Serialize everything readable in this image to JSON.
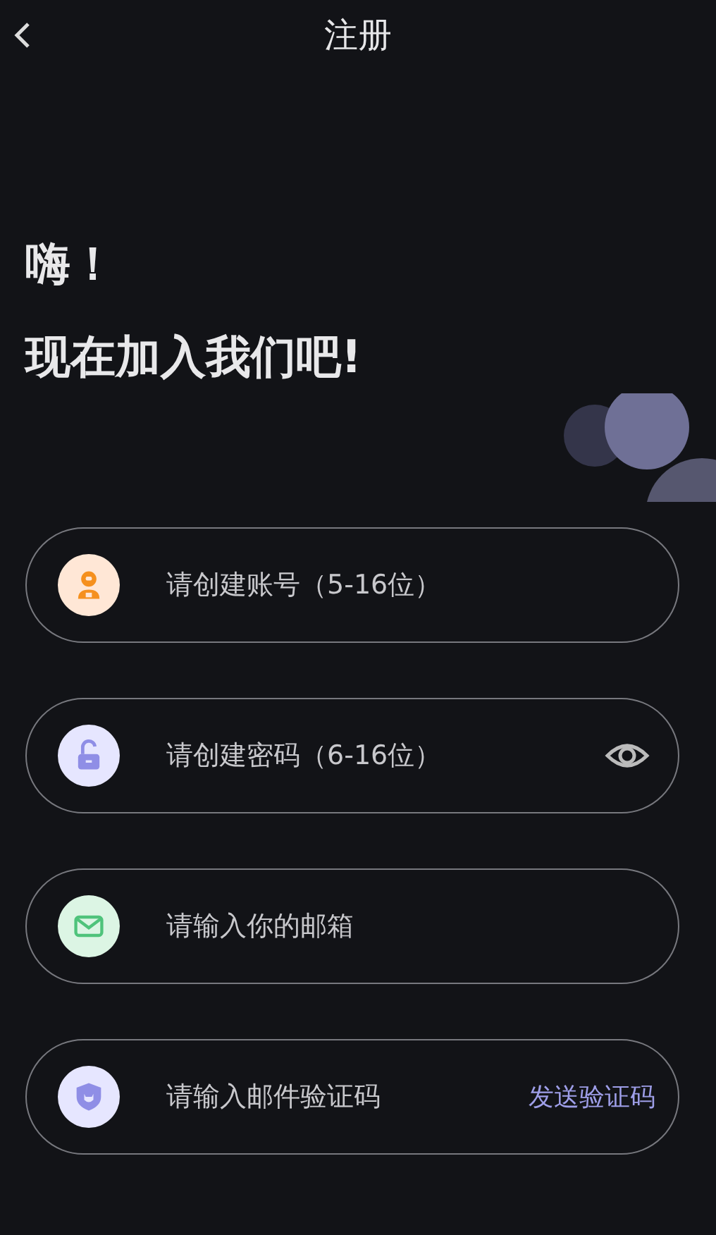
{
  "header": {
    "title": "注册"
  },
  "greeting": {
    "line1": "嗨！",
    "line2": "现在加入我们吧!"
  },
  "fields": [
    {
      "kind": "account",
      "placeholder": "请创建账号（5-16位）"
    },
    {
      "kind": "password",
      "placeholder": "请创建密码（6-16位）"
    },
    {
      "kind": "email",
      "placeholder": "请输入你的邮箱"
    },
    {
      "kind": "code",
      "placeholder": "请输入邮件验证码",
      "action": "发送验证码"
    }
  ]
}
